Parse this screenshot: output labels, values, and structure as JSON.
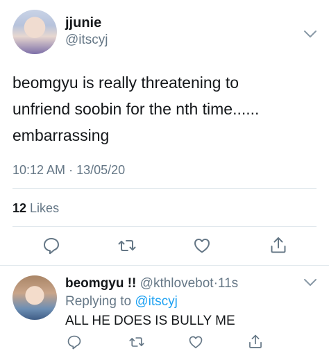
{
  "main_tweet": {
    "display_name": "jjunie",
    "handle": "@itscyj",
    "text_lines": [
      "beomgyu is really threatening to",
      "unfriend soobin for the nth time......",
      "embarrassing"
    ],
    "time": "10:12 AM",
    "separator": "·",
    "date": "13/05/20",
    "likes_count": "12",
    "likes_label": "Likes"
  },
  "reply_tweet": {
    "display_name": "beomgyu !!",
    "handle": "@kthlovebot",
    "separator": "·",
    "age": "11s",
    "replying_prefix": "Replying to",
    "replying_to": "@itscyj",
    "text": "ALL HE DOES IS BULLY ME"
  },
  "icons": {
    "more": "chevron-down-icon",
    "reply": "reply-icon",
    "retweet": "retweet-icon",
    "like": "heart-icon",
    "share": "share-icon"
  },
  "colors": {
    "text": "#14171a",
    "secondary": "#657786",
    "link": "#1da1f2",
    "divider": "#e1e8ed",
    "icon": "#657786"
  }
}
